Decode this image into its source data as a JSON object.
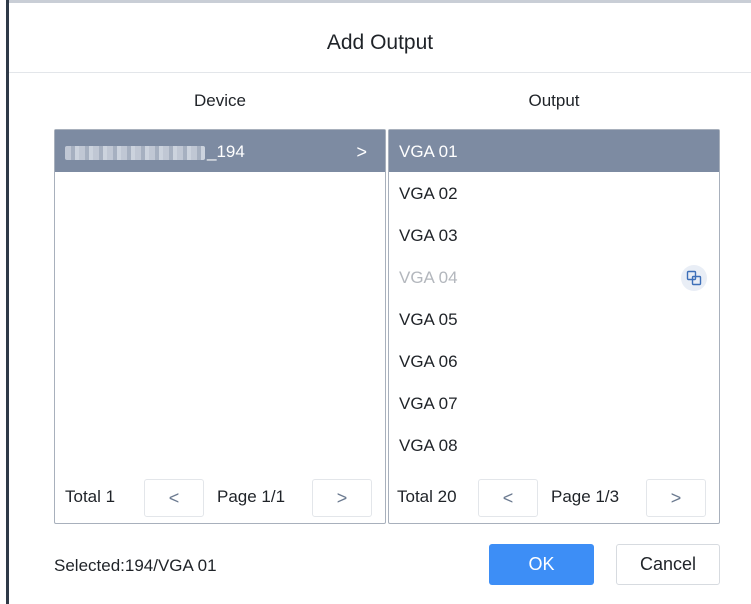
{
  "dialog": {
    "title": "Add Output",
    "ok_label": "OK",
    "cancel_label": "Cancel",
    "selected_text": "Selected:194/VGA 01"
  },
  "device": {
    "header": "Device",
    "items": [
      {
        "label": "_194",
        "selected": true
      }
    ],
    "total": "Total 1",
    "page": "Page 1/1",
    "prev_label": "<",
    "next_label": ">"
  },
  "output": {
    "header": "Output",
    "items": [
      {
        "label": "VGA 01",
        "state": "selected"
      },
      {
        "label": "VGA 02",
        "state": "normal"
      },
      {
        "label": "VGA 03",
        "state": "normal"
      },
      {
        "label": "VGA 04",
        "state": "disabled"
      },
      {
        "label": "VGA 05",
        "state": "normal"
      },
      {
        "label": "VGA 06",
        "state": "normal"
      },
      {
        "label": "VGA 07",
        "state": "normal"
      },
      {
        "label": "VGA 08",
        "state": "normal"
      }
    ],
    "total": "Total 20",
    "page": "Page 1/3",
    "prev_label": "<",
    "next_label": ">"
  },
  "icons": {
    "device_row_chevron": ">",
    "vga04_icon": "duplicate-icon"
  },
  "colors": {
    "selected_row": "#7d8ba2",
    "primary_button": "#3d8ef6",
    "disabled_text": "#b3b7bd",
    "panel_border": "#a8b0bc"
  }
}
